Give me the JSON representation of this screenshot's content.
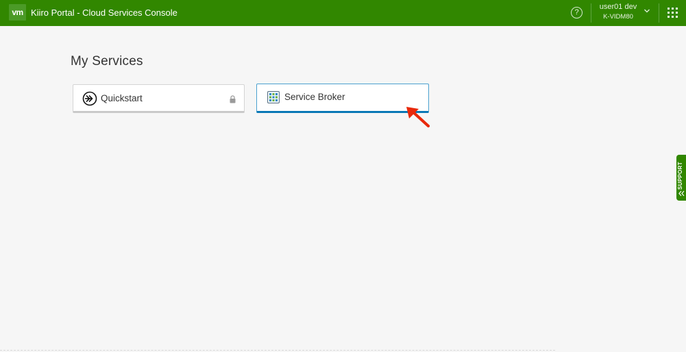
{
  "header": {
    "logo_text": "vm",
    "title": "Kiiro Portal - Cloud Services Console",
    "help_icon": "help-circle-icon",
    "help_symbol": "?",
    "user": {
      "name": "user01 dev",
      "tenant": "K-VIDM80"
    },
    "user_menu_icon": "chevron-down-icon",
    "apps_icon": "app-grid-icon",
    "brand_color": "#318700"
  },
  "main": {
    "title": "My Services",
    "services": [
      {
        "label": "Quickstart",
        "icon": "quickstart-arrow-icon",
        "locked": true
      },
      {
        "label": "Service Broker",
        "icon": "service-broker-icon",
        "locked": false,
        "selected": true,
        "accent": "#0a78b6"
      }
    ]
  },
  "support": {
    "label": "SUPPORT",
    "icon": "double-chevron-icon"
  },
  "annotation": {
    "icon": "red-pointer-arrow-icon",
    "color": "#e8290b"
  }
}
